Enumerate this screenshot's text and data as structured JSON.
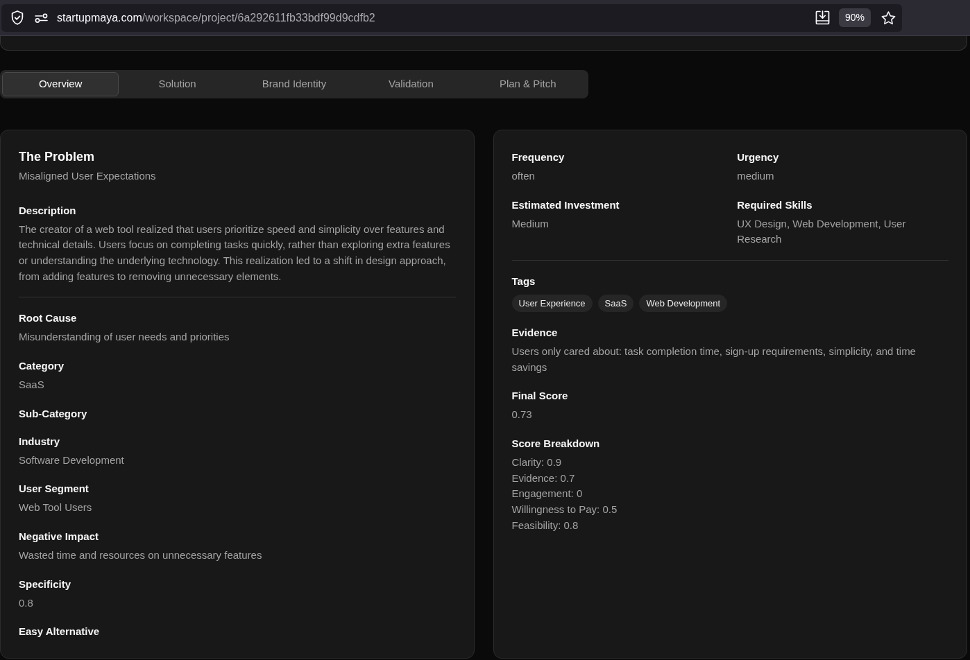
{
  "browser": {
    "url_host": "startupmaya.com",
    "url_path": "/workspace/project/6a292611fb33bdf99d9cdfb2",
    "zoom": "90%"
  },
  "tabs": [
    {
      "label": "Overview",
      "selected": true
    },
    {
      "label": "Solution",
      "selected": false
    },
    {
      "label": "Brand Identity",
      "selected": false
    },
    {
      "label": "Validation",
      "selected": false
    },
    {
      "label": "Plan & Pitch",
      "selected": false
    }
  ],
  "problem_card": {
    "title": "The Problem",
    "subtitle": "Misaligned User Expectations",
    "description": {
      "label": "Description",
      "text": "The creator of a web tool realized that users prioritize speed and simplicity over features and technical details. Users focus on completing tasks quickly, rather than exploring extra features or understanding the underlying technology. This realization led to a shift in design approach, from adding features to removing unnecessary elements."
    },
    "fields": [
      {
        "label": "Root Cause",
        "value": "Misunderstanding of user needs and priorities"
      },
      {
        "label": "Category",
        "value": "SaaS"
      },
      {
        "label": "Sub-Category"
      },
      {
        "label": "Industry",
        "value": "Software Development"
      },
      {
        "label": "User Segment",
        "value": "Web Tool Users"
      },
      {
        "label": "Negative Impact",
        "value": "Wasted time and resources on unnecessary features"
      },
      {
        "label": "Specificity",
        "value": "0.8"
      },
      {
        "label": "Easy Alternative"
      }
    ]
  },
  "details_card": {
    "facts": [
      {
        "label": "Frequency",
        "value": "often"
      },
      {
        "label": "Urgency",
        "value": "medium"
      },
      {
        "label": "Estimated Investment",
        "value": "Medium"
      },
      {
        "label": "Required Skills",
        "value": "UX Design, Web Development, User Research"
      }
    ],
    "tags": {
      "label": "Tags",
      "items": [
        "User Experience",
        "SaaS",
        "Web Development"
      ]
    },
    "sections": [
      {
        "kind": "text",
        "label": "Evidence",
        "value": "Users only cared about: task completion time, sign-up requirements, simplicity, and time savings"
      },
      {
        "kind": "text",
        "label": "Final Score",
        "value": "0.73"
      },
      {
        "kind": "list",
        "label": "Score Breakdown",
        "items": [
          "Clarity: 0.9",
          "Evidence: 0.7",
          "Engagement: 0",
          "Willingness to Pay: 0.5",
          "Feasibility: 0.8"
        ]
      }
    ]
  }
}
